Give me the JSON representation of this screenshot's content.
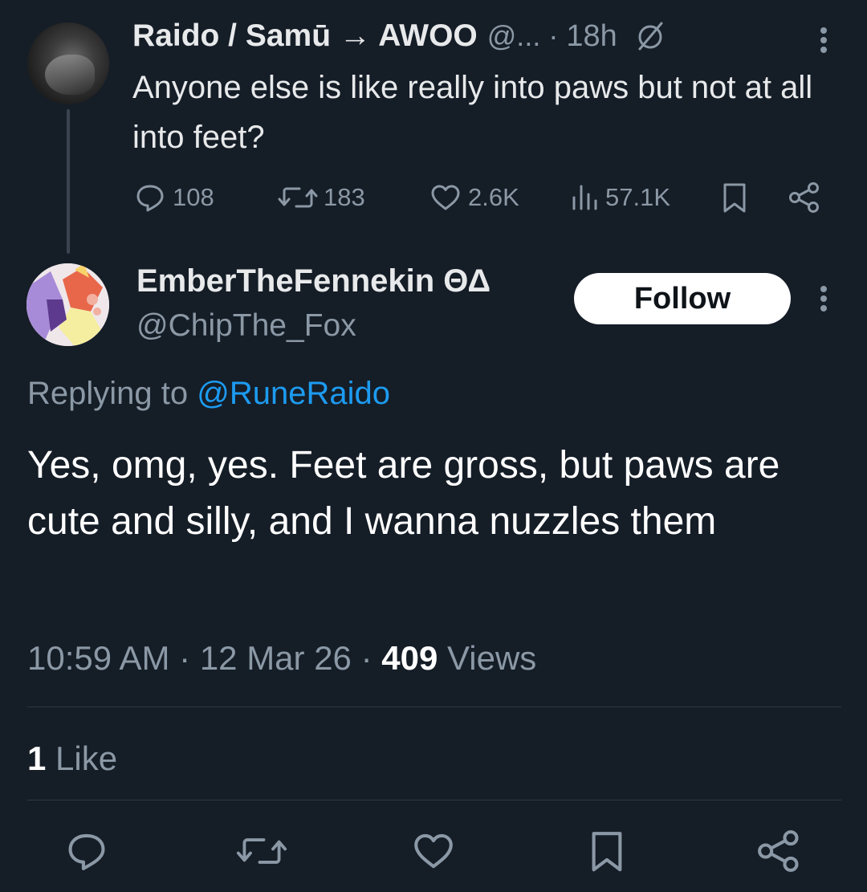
{
  "parent_tweet": {
    "author_name": "Raido / Samū → AWOO",
    "author_handle": "@...",
    "separator": "·",
    "time": "18h",
    "text": "Anyone else is like really into paws but not at all into feet?",
    "stats": {
      "replies": "108",
      "reposts": "183",
      "likes": "2.6K",
      "views": "57.1K"
    }
  },
  "reply": {
    "author_name": "EmberTheFennekin ΘΔ",
    "author_handle": "@ChipThe_Fox",
    "follow_label": "Follow",
    "replying_prefix": "Replying to",
    "replying_handle": "@RuneRaido",
    "text": "Yes, omg, yes. Feet are gross, but paws are cute and silly, and I wanna nuzzles them",
    "time": "10:59 AM",
    "date": "12 Mar 26",
    "separator": "·",
    "views_count": "409",
    "views_label": "Views",
    "likes_count": "1",
    "likes_label": "Like"
  },
  "colors": {
    "background": "#151d27",
    "text_primary": "#e7e9ea",
    "text_muted": "#8b98a5",
    "link": "#1d9bf0",
    "button_bg": "#ffffff"
  },
  "icons": {
    "parent_actions": [
      "reply-icon",
      "repost-icon",
      "like-icon",
      "views-icon",
      "bookmark-icon",
      "share-icon"
    ],
    "bottom_bar": [
      "reply-icon",
      "repost-icon",
      "like-icon",
      "bookmark-icon",
      "share-icon"
    ],
    "other": [
      "more-icon",
      "muted-circle-icon"
    ]
  }
}
